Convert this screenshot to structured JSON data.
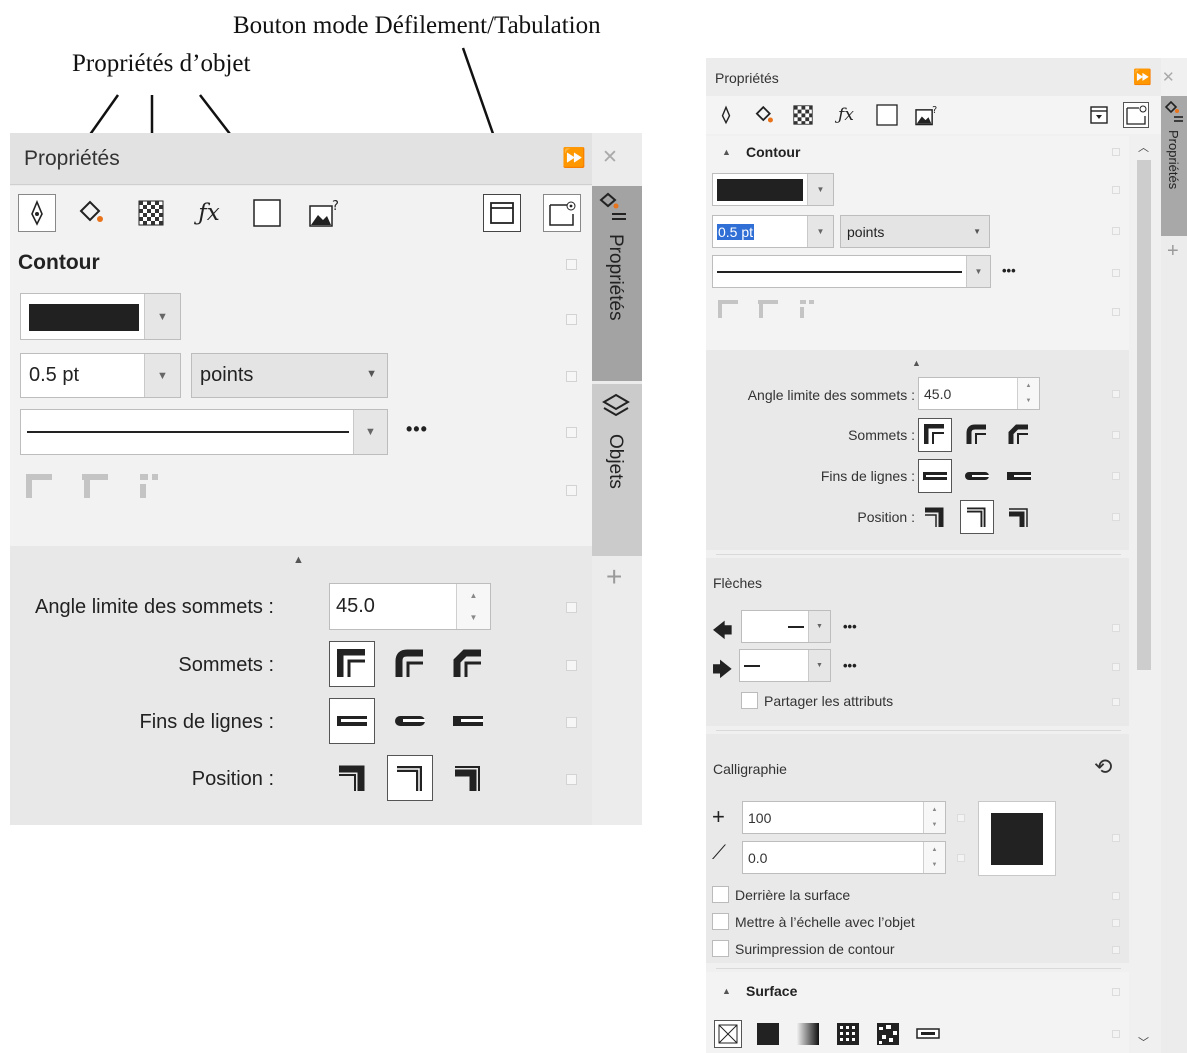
{
  "annotations": {
    "object_properties": "Propriétés d’objet",
    "scroll_tab_button": "Bouton mode Défilement/Tabulation"
  },
  "left_panel": {
    "title": "Propriétés",
    "forward_glyph": "⏩",
    "close_glyph": "✕",
    "section_title": "Contour",
    "width_value": "0.5 pt",
    "units": "points",
    "more": "•••",
    "miter_label": "Angle limite des sommets :",
    "miter_value": "45.0",
    "corners_label": "Sommets :",
    "caps_label": "Fins de lignes :",
    "position_label": "Position :",
    "tabs": {
      "properties": "Propriétés",
      "objects": "Objets"
    },
    "add": "+"
  },
  "right_panel": {
    "title": "Propriétés",
    "forward_glyph": "⏩",
    "close_glyph": "✕",
    "section_title": "Contour",
    "width_value": "0.5 pt",
    "units": "points",
    "more": "•••",
    "miter_label": "Angle limite des sommets :",
    "miter_value": "45.0",
    "corners_label": "Sommets :",
    "caps_label": "Fins de lignes :",
    "position_label": "Position :",
    "arrows_title": "Flèches",
    "share_label": "Partager les attributs",
    "calligraphy_title": "Calligraphie",
    "stretch_value": "100",
    "angle_value": "0.0",
    "behind_fill": "Derrière la surface",
    "scale_with_object": "Mettre à l’échelle avec l’objet",
    "overprint": "Surimpression de contour",
    "fill_title": "Surface",
    "tab_properties": "Propriétés",
    "add": "+"
  }
}
